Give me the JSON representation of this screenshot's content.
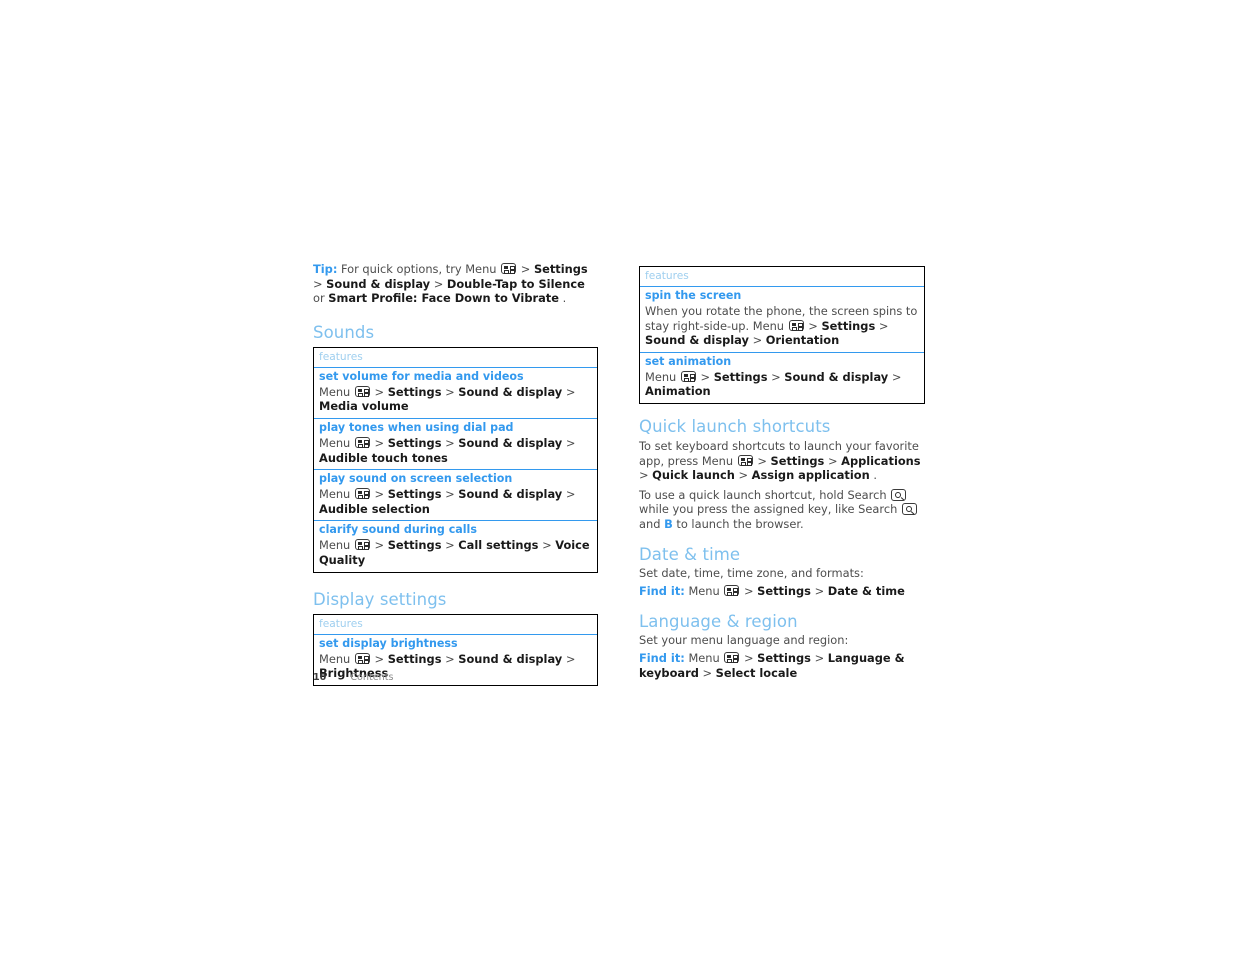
{
  "document": {
    "footer": {
      "page_number": "10",
      "label": "Contents"
    }
  },
  "left_column": {
    "tip": {
      "label": "Tip:",
      "text_before_icon": "For quick options, try Menu",
      "icon": "menu-icon",
      "seq": [
        {
          "t": ">",
          "style": "plain"
        },
        {
          "t": "Settings",
          "style": "bold"
        },
        {
          "t": ">",
          "style": "plain"
        },
        {
          "t": "Sound & display",
          "style": "bold"
        },
        {
          "t": ">",
          "style": "plain"
        },
        {
          "t": "Double-Tap to Silence",
          "style": "bold"
        },
        {
          "t": "or",
          "style": "plain"
        },
        {
          "t": "Smart Profile: Face Down to Vibrate",
          "style": "bold"
        },
        {
          "t": ".",
          "style": "plain"
        }
      ]
    },
    "sounds": {
      "heading": "Sounds",
      "table": {
        "header": "features",
        "rows": [
          {
            "title": "set volume for media and videos",
            "desc_prefix": "Menu",
            "icon": "menu-icon",
            "path": "> Settings > Sound & display > Media volume",
            "path_parts": [
              {
                "t": ">",
                "style": "plain"
              },
              {
                "t": "Settings",
                "style": "bold"
              },
              {
                "t": ">",
                "style": "plain"
              },
              {
                "t": "Sound & display",
                "style": "bold"
              },
              {
                "t": ">",
                "style": "plain"
              },
              {
                "t": "Media volume",
                "style": "bold"
              }
            ]
          },
          {
            "title": "play tones when using dial pad",
            "desc_prefix": "Menu",
            "icon": "menu-icon",
            "path_parts": [
              {
                "t": ">",
                "style": "plain"
              },
              {
                "t": "Settings",
                "style": "bold"
              },
              {
                "t": ">",
                "style": "plain"
              },
              {
                "t": "Sound & display",
                "style": "bold"
              },
              {
                "t": ">",
                "style": "plain"
              },
              {
                "t": "Audible touch tones",
                "style": "bold"
              }
            ]
          },
          {
            "title": "play sound on screen selection",
            "desc_prefix": "Menu",
            "icon": "menu-icon",
            "path_parts": [
              {
                "t": ">",
                "style": "plain"
              },
              {
                "t": "Settings",
                "style": "bold"
              },
              {
                "t": ">",
                "style": "plain"
              },
              {
                "t": "Sound & display",
                "style": "bold"
              },
              {
                "t": ">",
                "style": "plain"
              },
              {
                "t": "Audible selection",
                "style": "bold"
              }
            ]
          },
          {
            "title": "clarify sound during calls",
            "desc_prefix": "Menu",
            "icon": "menu-icon",
            "path_parts": [
              {
                "t": ">",
                "style": "plain"
              },
              {
                "t": "Settings",
                "style": "bold"
              },
              {
                "t": ">",
                "style": "plain"
              },
              {
                "t": "Call settings",
                "style": "bold"
              },
              {
                "t": ">",
                "style": "plain"
              },
              {
                "t": "Voice Quality",
                "style": "bold"
              }
            ]
          }
        ]
      }
    },
    "display_settings": {
      "heading": "Display settings",
      "table": {
        "header": "features",
        "rows": [
          {
            "title": "set display brightness",
            "desc_prefix": "Menu",
            "icon": "menu-icon",
            "path_parts": [
              {
                "t": ">",
                "style": "plain"
              },
              {
                "t": "Settings",
                "style": "bold"
              },
              {
                "t": ">",
                "style": "plain"
              },
              {
                "t": "Sound & display",
                "style": "bold"
              },
              {
                "t": ">",
                "style": "plain"
              },
              {
                "t": "Brightness",
                "style": "bold"
              }
            ]
          }
        ]
      }
    }
  },
  "right_column": {
    "display_table": {
      "header": "features",
      "rows": [
        {
          "title": "spin the screen",
          "desc_prefix": "When you rotate the phone, the screen spins to stay right-side-up. Menu",
          "icon": "menu-icon",
          "path_parts": [
            {
              "t": ">",
              "style": "plain"
            },
            {
              "t": "Settings",
              "style": "bold"
            },
            {
              "t": ">",
              "style": "plain"
            },
            {
              "t": "Sound & display",
              "style": "bold"
            },
            {
              "t": ">",
              "style": "plain"
            },
            {
              "t": "Orientation",
              "style": "bold"
            }
          ]
        },
        {
          "title": "set animation",
          "desc_prefix": "Menu",
          "icon": "menu-icon",
          "path_parts": [
            {
              "t": ">",
              "style": "plain"
            },
            {
              "t": "Settings",
              "style": "bold"
            },
            {
              "t": ">",
              "style": "plain"
            },
            {
              "t": "Sound & display",
              "style": "bold"
            },
            {
              "t": ">",
              "style": "plain"
            },
            {
              "t": "Animation",
              "style": "bold"
            }
          ]
        }
      ]
    },
    "quick_launch": {
      "heading": "Quick launch shortcuts",
      "para1_prefix": "To set keyboard shortcuts to launch your favorite app, press Menu",
      "para1_parts": [
        {
          "t": ">",
          "style": "plain"
        },
        {
          "t": "Settings",
          "style": "bold"
        },
        {
          "t": ">",
          "style": "plain"
        },
        {
          "t": "Applications",
          "style": "bold"
        },
        {
          "t": ">",
          "style": "plain"
        },
        {
          "t": "Quick launch",
          "style": "bold"
        },
        {
          "t": ">",
          "style": "plain"
        },
        {
          "t": "Assign application",
          "style": "bold"
        },
        {
          "t": ".",
          "style": "plain"
        }
      ],
      "para2_seg1": "To use a quick launch shortcut, hold Search",
      "para2_seg2": "while you press the assigned key, like Search",
      "para2_seg3": "and",
      "para2_key": "B",
      "para2_seg4": "to launch the browser."
    },
    "date_time": {
      "heading": "Date & time",
      "intro": "Set date, time, time zone, and formats:",
      "find_it_label": "Find it:",
      "find_it_prefix": "Menu",
      "find_it_parts": [
        {
          "t": ">",
          "style": "plain"
        },
        {
          "t": "Settings",
          "style": "bold"
        },
        {
          "t": ">",
          "style": "plain"
        },
        {
          "t": "Date & time",
          "style": "bold"
        }
      ]
    },
    "language_region": {
      "heading": "Language & region",
      "intro": "Set your menu language and region:",
      "find_it_label": "Find it:",
      "find_it_prefix": "Menu",
      "find_it_parts": [
        {
          "t": ">",
          "style": "plain"
        },
        {
          "t": "Settings",
          "style": "bold"
        },
        {
          "t": ">",
          "style": "plain"
        },
        {
          "t": "Language & keyboard",
          "style": "bold"
        },
        {
          "t": ">",
          "style": "plain"
        },
        {
          "t": "Select locale",
          "style": "bold"
        }
      ]
    }
  },
  "colors": {
    "heading_blue": "#7ec0ee",
    "accent_blue": "#3399ee",
    "table_header_blue": "#9fcfef",
    "body_gray": "#4d4d4d",
    "bold_black": "#1a1a1a",
    "border_black": "#000000"
  }
}
